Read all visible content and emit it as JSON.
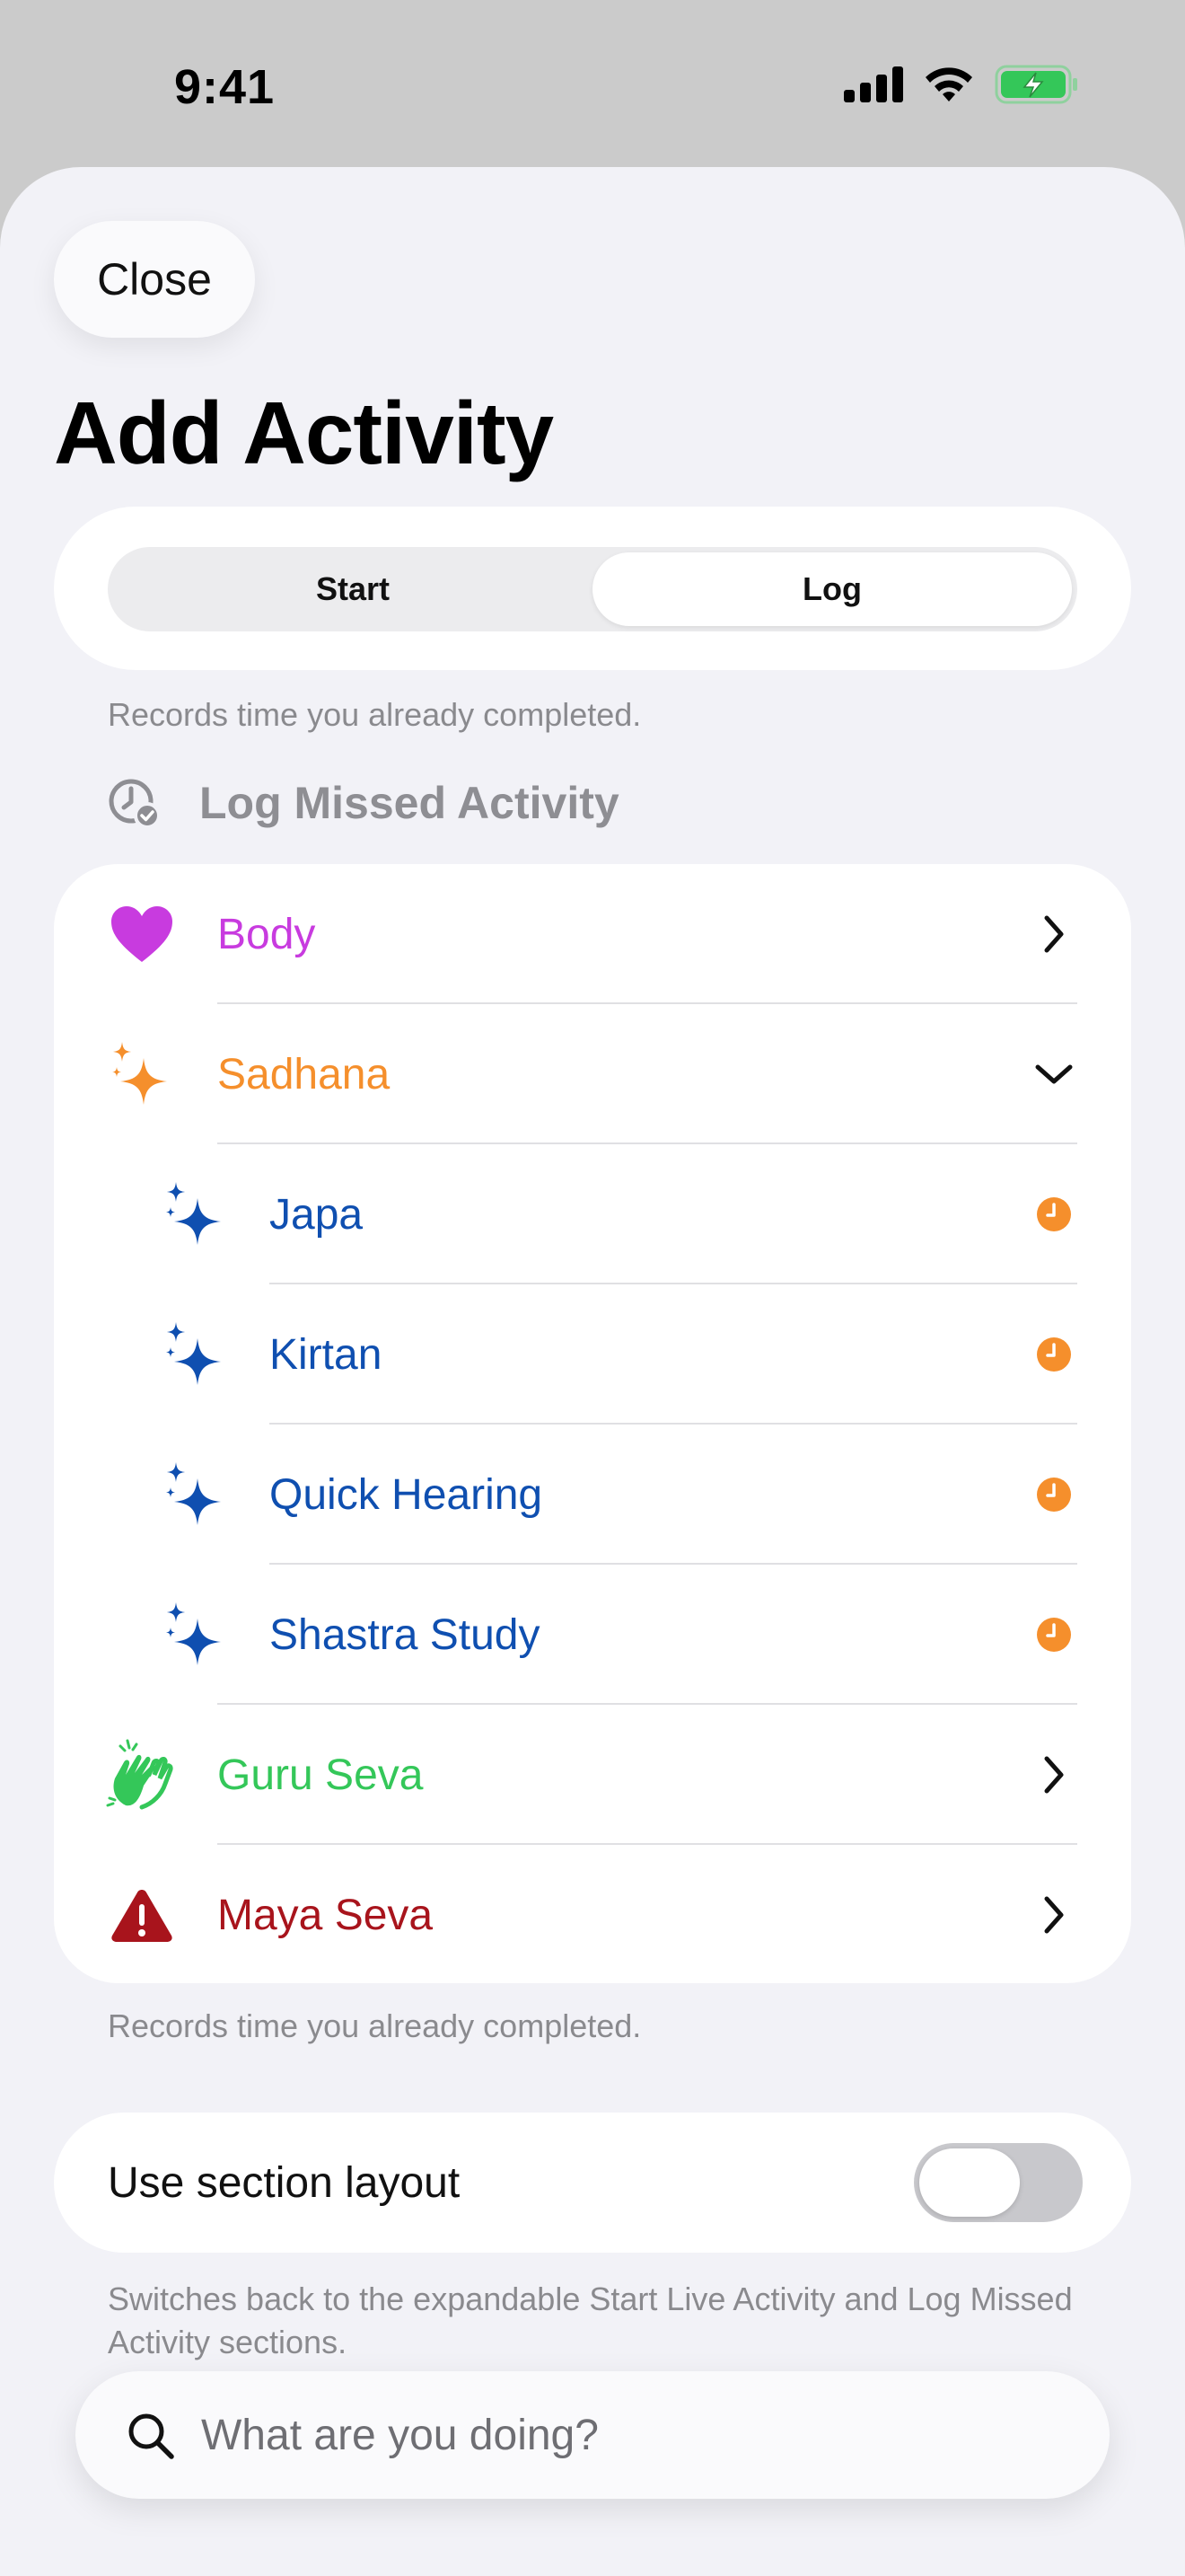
{
  "status": {
    "time": "9:41",
    "icons": [
      "cellular-signal-icon",
      "wifi-icon",
      "battery-charging-icon"
    ]
  },
  "header": {
    "close_label": "Close",
    "title": "Add Activity"
  },
  "mode_picker": {
    "options": [
      {
        "label": "Start",
        "selected": false
      },
      {
        "label": "Log",
        "selected": true
      }
    ],
    "footnote": "Records time you already completed."
  },
  "section": {
    "icon": "clock-checkmark-icon",
    "title": "Log Missed Activity"
  },
  "categories": [
    {
      "label": "Body",
      "icon": "heart-icon",
      "color": "#c83bdf",
      "trailing": "chevron-right-icon"
    },
    {
      "label": "Sadhana",
      "icon": "sparkles-icon",
      "color": "#f58f2c",
      "trailing": "chevron-down-icon"
    },
    {
      "label": "Japa",
      "icon": "sparkles-icon",
      "color": "#0f4fb0",
      "trailing": "orange-clock-icon"
    },
    {
      "label": "Kirtan",
      "icon": "sparkles-icon",
      "color": "#0f4fb0",
      "trailing": "orange-clock-icon"
    },
    {
      "label": "Quick Hearing",
      "icon": "sparkles-icon",
      "color": "#0f4fb0",
      "trailing": "orange-clock-icon"
    },
    {
      "label": "Shastra Study",
      "icon": "sparkles-icon",
      "color": "#0f4fb0",
      "trailing": "orange-clock-icon"
    },
    {
      "label": "Guru Seva",
      "icon": "hands-clapping-icon",
      "color": "#34c759",
      "trailing": "chevron-right-icon"
    },
    {
      "label": "Maya Seva",
      "icon": "warning-triangle-icon",
      "color": "#a8141c",
      "trailing": "chevron-right-icon"
    }
  ],
  "list_footnote": "Records time you already completed.",
  "layout_toggle": {
    "label": "Use section layout",
    "on": false,
    "footnote": "Switches back to the expandable Start Live Activity and Log Missed Activity sections."
  },
  "search": {
    "placeholder": "What are you doing?",
    "value": ""
  },
  "colors": {
    "accent_orange": "#f58f2c",
    "sheet_background": "#f2f2f7",
    "battery_green": "#34c759"
  }
}
